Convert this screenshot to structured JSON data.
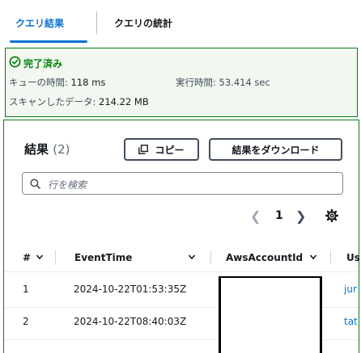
{
  "tabs": [
    {
      "label": "クエリ結果",
      "active": true
    },
    {
      "label": "クエリの統計",
      "active": false
    }
  ],
  "status": {
    "title": "完了済み",
    "queue_label": "キューの時間:",
    "queue_value": "118 ms",
    "exec_label": "実行時間:",
    "exec_value": "53.414 sec",
    "scan_label": "スキャンしたデータ:",
    "scan_value": "214.22 MB"
  },
  "results": {
    "title": "結果",
    "count": "(2)",
    "copy_label": "コピー",
    "download_label": "結果をダウンロード",
    "search_placeholder": "行を検索",
    "page": "1"
  },
  "table": {
    "columns": [
      "#",
      "EventTime",
      "AwsAccountId",
      "Us"
    ],
    "rows": [
      {
        "num": "1",
        "event_time": "2024-10-22T01:53:35Z",
        "user": "jur"
      },
      {
        "num": "2",
        "event_time": "2024-10-22T08:40:03Z",
        "user": "tat"
      }
    ]
  },
  "colors": {
    "accent": "#0972d3",
    "success": "#037f0c"
  }
}
